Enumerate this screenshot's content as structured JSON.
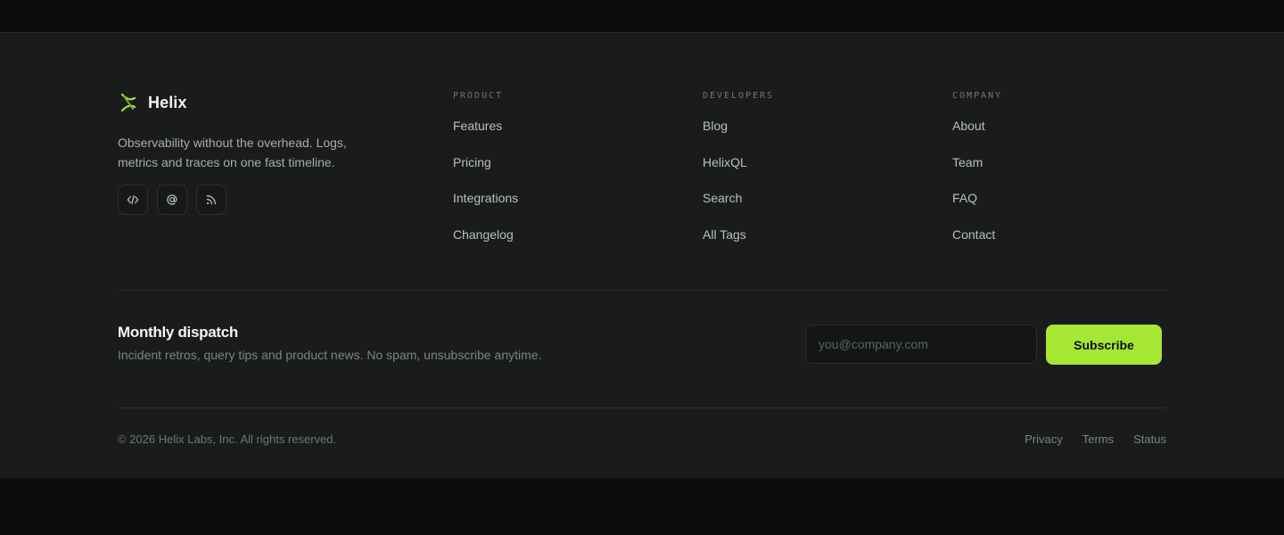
{
  "brand": {
    "name": "Helix",
    "tagline": "Observability without the overhead. Logs, metrics and traces on one fast timeline.",
    "accent": "#a6e635"
  },
  "socials": [
    {
      "icon": "code-icon",
      "label": "Code"
    },
    {
      "icon": "at-sign-icon",
      "label": "Email"
    },
    {
      "icon": "rss-icon",
      "label": "RSS"
    }
  ],
  "columns": [
    {
      "title": "PRODUCT",
      "links": [
        "Features",
        "Pricing",
        "Integrations",
        "Changelog"
      ]
    },
    {
      "title": "DEVELOPERS",
      "links": [
        "Blog",
        "HelixQL",
        "Search",
        "All Tags"
      ]
    },
    {
      "title": "COMPANY",
      "links": [
        "About",
        "Team",
        "FAQ",
        "Contact"
      ]
    }
  ],
  "newsletter": {
    "title": "Monthly dispatch",
    "subtitle": "Incident retros, query tips and product news. No spam, unsubscribe anytime.",
    "placeholder": "you@company.com",
    "value": "",
    "button": "Subscribe"
  },
  "bottom": {
    "copyright": "© 2026 Helix Labs, Inc. All rights reserved.",
    "links": [
      "Privacy",
      "Terms",
      "Status"
    ]
  }
}
